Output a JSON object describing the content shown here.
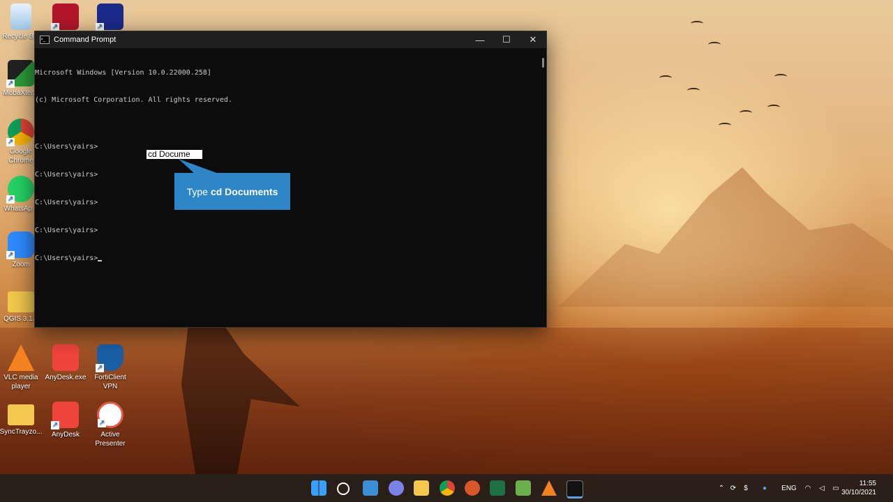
{
  "desktop": {
    "icons": [
      {
        "label": "Recycle B..."
      },
      {
        "label": ""
      },
      {
        "label": ""
      },
      {
        "label": "MobaXter..."
      },
      {
        "label": "Google Chrome"
      },
      {
        "label": "WhatsAp..."
      },
      {
        "label": "Zoom"
      },
      {
        "label": "QGIS 3.1..."
      },
      {
        "label": "VLC media player"
      },
      {
        "label": "AnyDesk.exe"
      },
      {
        "label": "FortiClient VPN"
      },
      {
        "label": "SyncTrayzo..."
      },
      {
        "label": "AnyDesk"
      },
      {
        "label": "Active Presenter"
      }
    ]
  },
  "window": {
    "title": "Command Prompt",
    "console_lines": [
      "Microsoft Windows [Version 10.0.22000.258]",
      "(c) Microsoft Corporation. All rights reserved.",
      "",
      "C:\\Users\\yairs>",
      "C:\\Users\\yairs>",
      "C:\\Users\\yairs>",
      "C:\\Users\\yairs>",
      "C:\\Users\\yairs>"
    ],
    "controls": {
      "minimize": "—",
      "maximize": "☐",
      "close": "✕"
    }
  },
  "overlay": {
    "typed_text": "cd Docume",
    "callout_prefix": "Type",
    "callout_bold": "cd Documents"
  },
  "taskbar": {
    "tray": {
      "language": "ENG"
    },
    "clock": {
      "time": "11:55",
      "date": "30/10/2021"
    }
  },
  "colors": {
    "callout": "#2e86c8",
    "console_bg": "#0c0c0c",
    "taskbar": "#1e1a18"
  }
}
